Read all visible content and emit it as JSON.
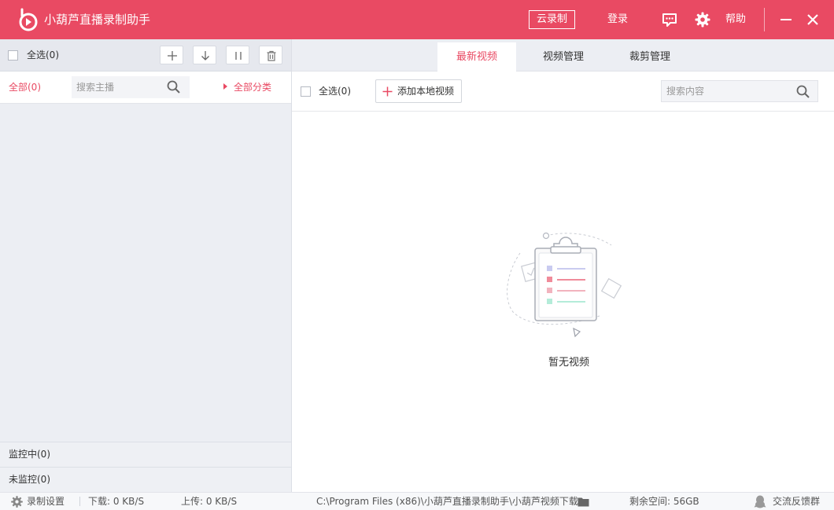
{
  "app": {
    "title": "小葫芦直播录制助手",
    "accent_color": "#e94a63"
  },
  "titlebar": {
    "cloud_record": "云录制",
    "login": "登录",
    "help": "帮助",
    "icons": [
      "message-icon",
      "gear-icon",
      "minimize-icon",
      "close-icon"
    ]
  },
  "left_panel": {
    "select_all": "全选(0)",
    "tools": [
      "add-icon",
      "download-icon",
      "pause-icon",
      "trash-icon"
    ],
    "all_count": "全部(0)",
    "search_placeholder": "搜索主播",
    "all_categories": "全部分类",
    "monitoring": "监控中(0)",
    "not_monitoring": "未监控(0)"
  },
  "tabs": [
    {
      "label": "最新视频",
      "active": true
    },
    {
      "label": "视频管理",
      "active": false
    },
    {
      "label": "裁剪管理",
      "active": false
    }
  ],
  "toolbar": {
    "select_all": "全选(0)",
    "add_local": "添加本地视频",
    "search_placeholder": "搜索内容"
  },
  "empty_state": {
    "text": "暂无视频"
  },
  "statusbar": {
    "record_settings": "录制设置",
    "download": "下载: 0 KB/S",
    "upload": "上传: 0 KB/S",
    "path": "C:\\Program Files (x86)\\小葫芦直播录制助手\\小葫芦视频下载",
    "free_space": "剩余空间: 56GB",
    "feedback": "交流反馈群"
  }
}
